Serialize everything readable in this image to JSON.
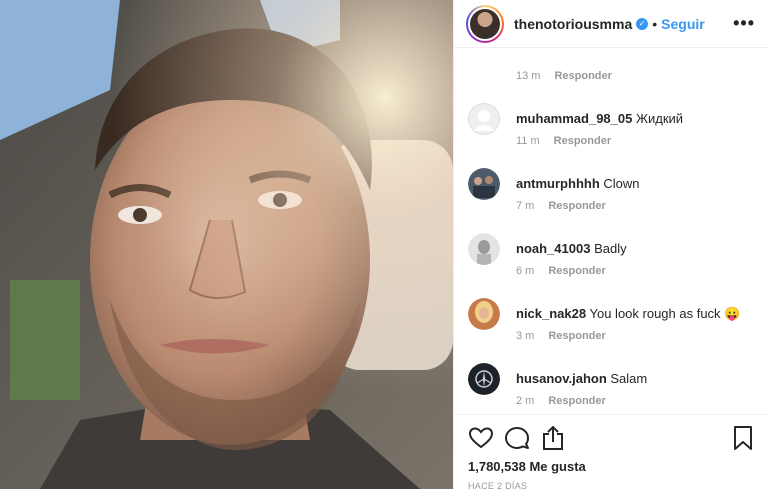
{
  "post": {
    "username": "thenotoriousmma",
    "dot": "•",
    "follow_label": "Seguir",
    "more_label": "•••",
    "verified_mark": "✓"
  },
  "comments": {
    "top_time": "13 m",
    "top_reply": "Responder",
    "items": [
      {
        "user": "muhammad_98_05",
        "text": "Жидкий",
        "time": "11 m",
        "reply": "Responder",
        "avatar": "default-avatar"
      },
      {
        "user": "antmurphhhh",
        "text": "Clown",
        "time": "7 m",
        "reply": "Responder",
        "avatar": "group-photo-avatar"
      },
      {
        "user": "noah_41003",
        "text": "Badly",
        "time": "6 m",
        "reply": "Responder",
        "avatar": "light-avatar"
      },
      {
        "user": "nick_nak28",
        "text": "You look rough as fuck 😛",
        "time": "3 m",
        "reply": "Responder",
        "avatar": "blonde-avatar"
      },
      {
        "user": "husanov.jahon",
        "text": "Salam",
        "time": "2 m",
        "reply": "Responder",
        "avatar": "car-logo-avatar"
      }
    ]
  },
  "actions": {
    "likes": "1,780,538 Me gusta",
    "posted_ago": "HACE 2 DÍAS",
    "icons": [
      "heart-icon",
      "comment-icon",
      "share-icon",
      "bookmark-icon"
    ]
  },
  "colors": {
    "accent": "#3897f0",
    "text": "#262626",
    "muted": "#999999",
    "border": "#efefef"
  }
}
